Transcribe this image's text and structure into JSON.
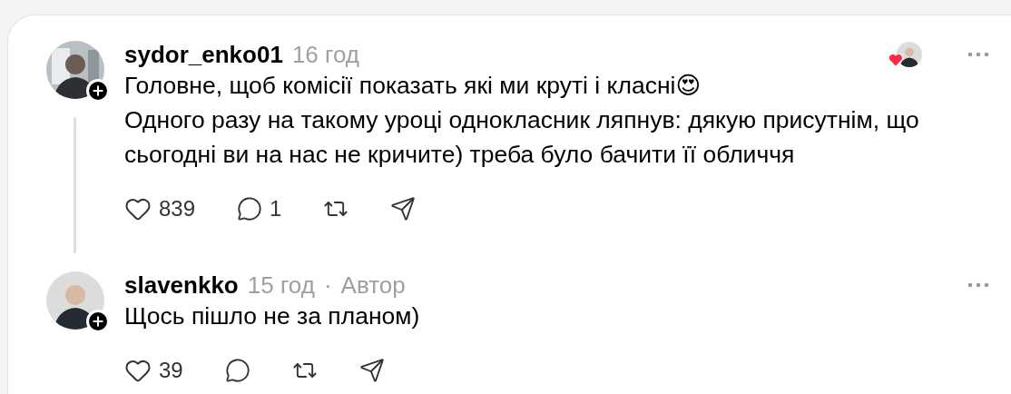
{
  "comments": [
    {
      "username": "sydor_enko01",
      "time": "16 год",
      "author_liked": true,
      "has_thread": true,
      "paragraphs": [
        "Головне, щоб комісії показать які ми круті і класні😍",
        "Одного разу на такому уроці однокласник ляпнув: дякую присутнім, що сьогодні ви на нас не кричите) треба було бачити її обличчя"
      ],
      "likes": "839",
      "replies": "1"
    },
    {
      "username": "slavenkko",
      "time": "15 год",
      "separator": "·",
      "author_label": "Автор",
      "author_liked": false,
      "has_thread": false,
      "paragraphs": [
        "Щось пішло не за планом)"
      ],
      "likes": "39"
    }
  ]
}
